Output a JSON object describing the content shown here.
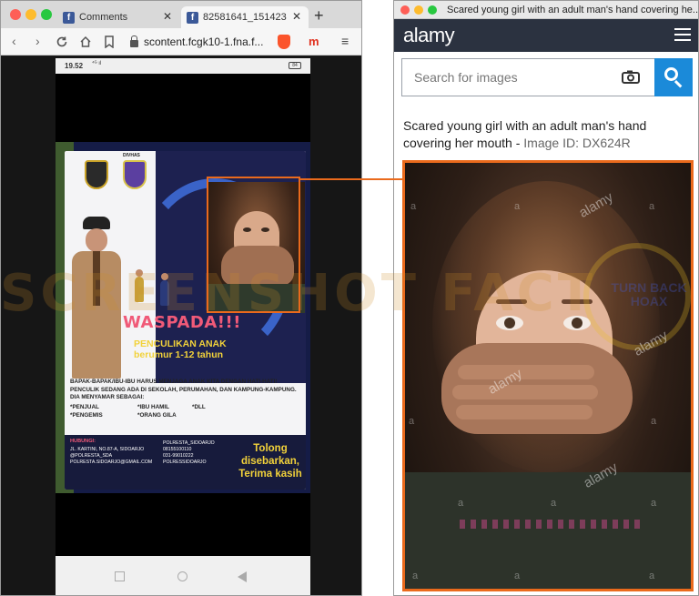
{
  "left_browser": {
    "tabs": [
      {
        "label": "Comments",
        "icon": "facebook-icon"
      },
      {
        "label": "82581641_1514238...",
        "icon": "facebook-icon"
      }
    ],
    "close_glyph": "✕",
    "new_tab_glyph": "+",
    "url": "scontent.fcgk10-1.fna.f...",
    "mobile_logo": "m",
    "phone": {
      "time": "19.52",
      "status_icons": "⁴ᴳ ıl",
      "battery": "84"
    }
  },
  "poster": {
    "crest_label": "DIVHAS",
    "headline": "WASPADA!!!",
    "subheadline": "PENCULIKAN ANAK",
    "age_line": "berumur 1-12 tahun",
    "body": [
      "BAPAK-BAPAK/IBU-IBU HARUS MENJAGA ANAK KITA DENGAN HATI-HATI!",
      "PENCULIK SEDANG ADA DI SEKOLAH, PERUMAHAN, DAN KAMPUNG-KAMPUNG.",
      "DIA MENYAMAR SEBAGAI:"
    ],
    "disguises_col1": [
      "*PENJUAL",
      "*PENGEMIS"
    ],
    "disguises_col2": [
      "*IBU HAMIL",
      "*ORANG GILA"
    ],
    "disguises_col3": [
      "*DLL"
    ],
    "contact_heading": "HUBUNGI:",
    "contacts_left": [
      "JL. KARTINI, NO.87-A, SIDOARJO",
      "@POLRESTA_SDA",
      "POLRESTA.SIDOARJO@GMAIL.COM"
    ],
    "contacts_right": [
      "POLRESTA_SIDOARJO",
      "08155100110",
      "031-99010222",
      "POLRESSIDOARJO"
    ],
    "closing": "Tolong disebarkan, Terima kasih"
  },
  "watermark": "SCREENSHOT FACT",
  "right_browser": {
    "window_title": "Scared young girl with an adult man's hand covering he...",
    "logo": "alamy",
    "search_placeholder": "Search for images",
    "caption": "Scared young girl with an adult man's hand covering her mouth - ",
    "image_id": "Image ID: DX624R",
    "photo_watermark": "alamy",
    "photo_letter": "a",
    "stamp_text": "TURN BACK HOAX"
  },
  "colors": {
    "highlight": "#ea6a1c",
    "alamy_header": "#2b3240",
    "search_button": "#1b8ad9",
    "poster_pink": "#f05a78",
    "poster_yellow": "#f2d23a"
  }
}
